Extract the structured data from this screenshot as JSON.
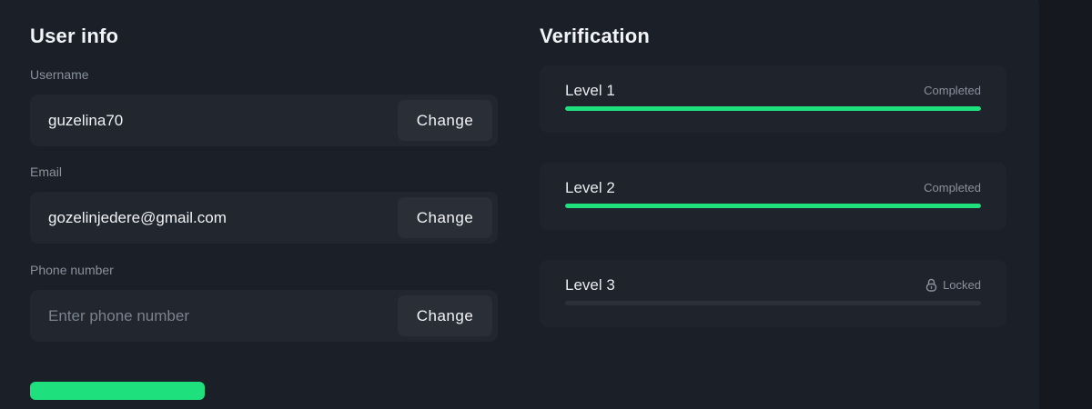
{
  "user_info": {
    "title": "User info",
    "username": {
      "label": "Username",
      "value": "guzelina70",
      "change_label": "Change"
    },
    "email": {
      "label": "Email",
      "value": "gozelinjedere@gmail.com",
      "change_label": "Change"
    },
    "phone": {
      "label": "Phone number",
      "value": "",
      "placeholder": "Enter phone number",
      "change_label": "Change"
    }
  },
  "verification": {
    "title": "Verification",
    "levels": [
      {
        "name": "Level 1",
        "status": "Completed",
        "progress": 1.0
      },
      {
        "name": "Level 2",
        "status": "Completed",
        "progress": 1.0
      },
      {
        "name": "Level 3",
        "status": "Locked",
        "progress": 0.0,
        "icon": "lock-icon"
      }
    ]
  },
  "colors": {
    "accent": "#1ee17d",
    "background": "#15191f",
    "panel": "#1b1f27",
    "field": "#22262e",
    "muted_text": "#8a919c"
  }
}
